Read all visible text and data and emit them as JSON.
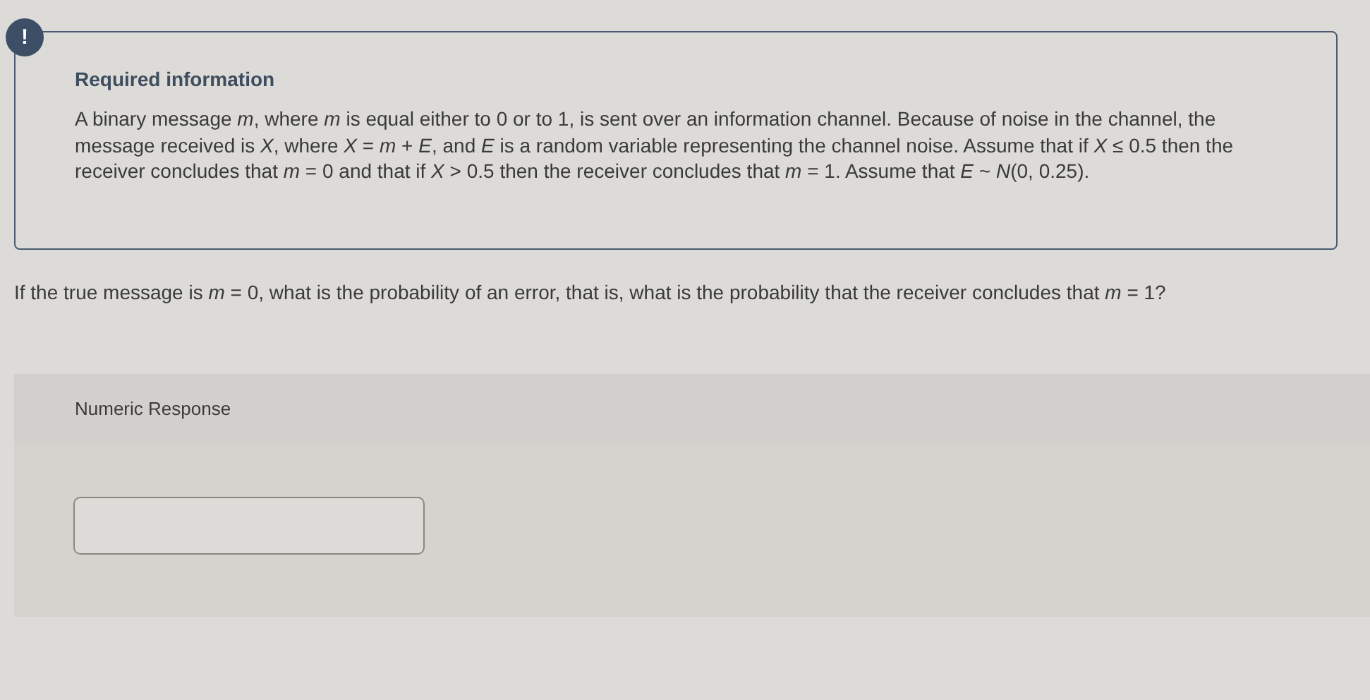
{
  "info_box": {
    "badge": "!",
    "title": "Required information",
    "text": "A binary message *m*, where *m* is equal either to 0 or to 1, is sent over an information channel. Because of noise in the channel, the message received is *X*, where *X* = *m* + *E*, and *E* is a random variable representing the channel noise. Assume that if *X* ≤ 0.5 then the receiver concludes that *m* = 0 and that if *X* > 0.5 then the receiver concludes that *m* = 1. Assume that *E* ~ *N*(0, 0.25)."
  },
  "question": "If the true message is *m* = 0, what is the probability of an error, that is, what is the probability that the receiver concludes that *m* = 1?",
  "response": {
    "label": "Numeric Response"
  }
}
